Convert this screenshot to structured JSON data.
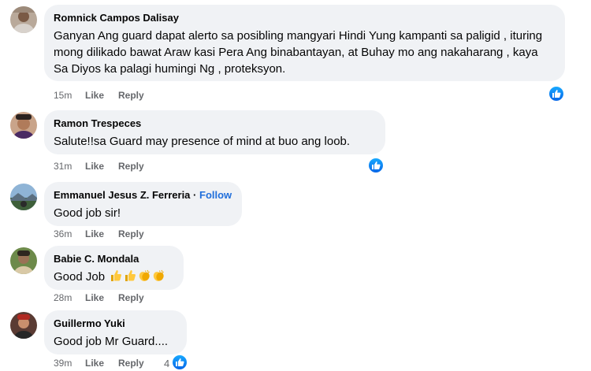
{
  "comments": [
    {
      "author": "Romnick Campos Dalisay",
      "text": "Ganyan Ang guard dapat alerto sa posibling mangyari Hindi Yung kampanti sa paligid , ituring mong dilikado bawat Araw kasi Pera Ang binabantayan, at Buhay mo ang nakaharang , kaya Sa Diyos ka palagi humingi Ng , proteksyon.",
      "time": "15m",
      "like": "Like",
      "reply": "Reply"
    },
    {
      "author": "Ramon Trespeces",
      "text": "Salute!!sa Guard may presence of mind at buo ang loob.",
      "time": "31m",
      "like": "Like",
      "reply": "Reply"
    },
    {
      "author": "Emmanuel Jesus Z. Ferreria",
      "dot": "·",
      "follow": "Follow",
      "text": "Good job sir!",
      "time": "36m",
      "like": "Like",
      "reply": "Reply"
    },
    {
      "author": "Babie C. Mondala",
      "text": "Good Job",
      "emojis": [
        "thumbs-up",
        "thumbs-up",
        "clapping-hands",
        "clapping-hands"
      ],
      "time": "28m",
      "like": "Like",
      "reply": "Reply"
    },
    {
      "author": "Guillermo Yuki",
      "text": "Good job Mr Guard....",
      "time": "39m",
      "like": "Like",
      "reply": "Reply",
      "reaction_count": "4"
    }
  ],
  "colors": {
    "bubble": "#f0f2f5",
    "meta": "#65676b",
    "follow": "#216fdb",
    "like_badge": "#1877f2"
  }
}
